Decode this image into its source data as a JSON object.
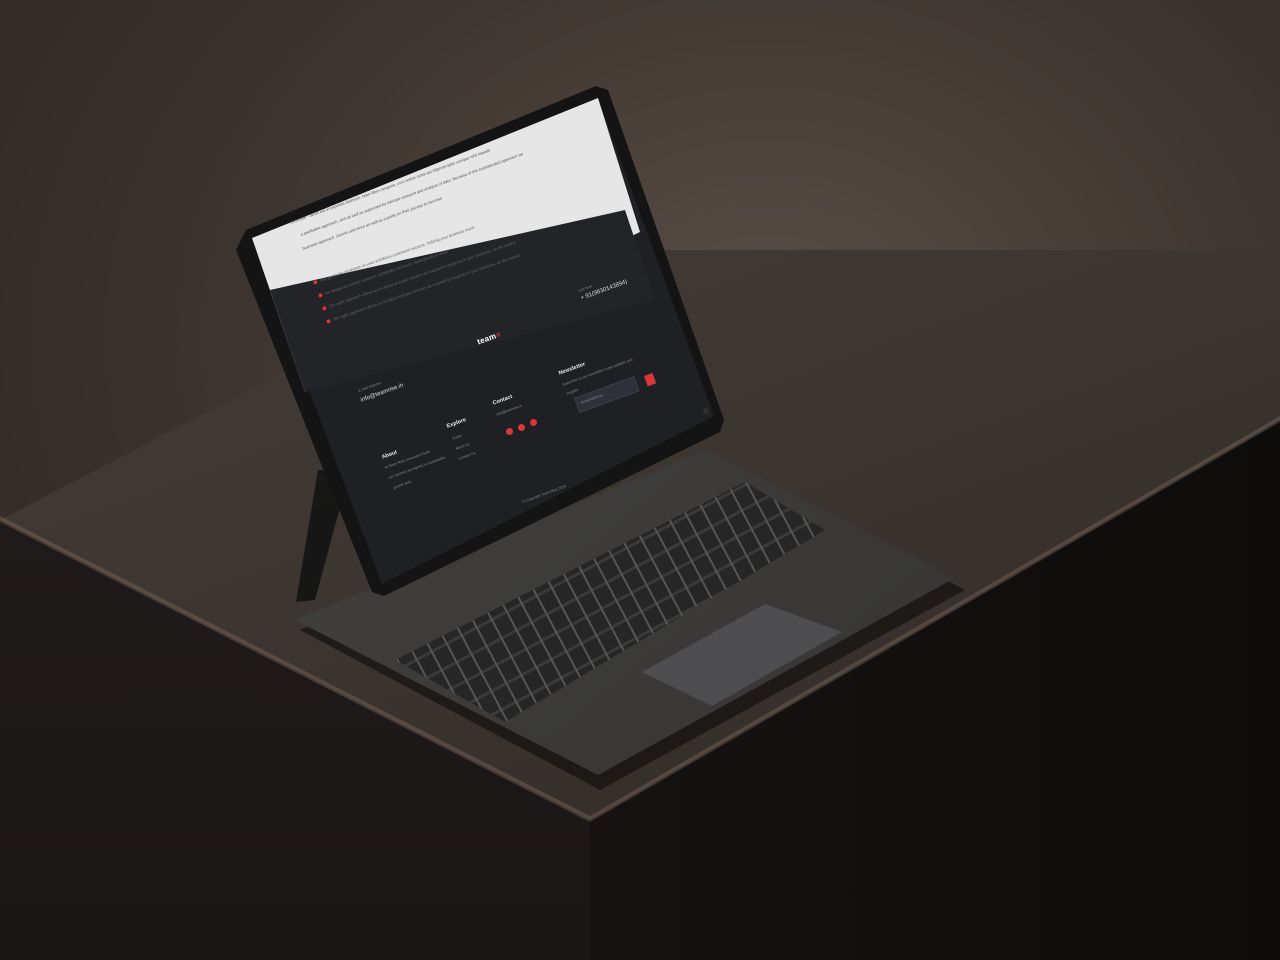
{
  "content": {
    "paragraphs": [
      "conciliate - facilis est et expedita distinctio. Nam libero tempore, cum soluta nobis est eligendi optio cumque nihil impedit",
      "a qualitative approach, and as well as supported by intricate research and analysis of data. Because of the sophisticated approach we",
      "business approach. Dennis and more as well as a pretty on their journey to success"
    ],
    "bullets": [
      "Pay particular emphasis on your ambitious customers success. Helping your business reach",
      "we always do market research, competitor research, strategically is ready",
      "Our agile approach allows us to adjust and gain traction as required to progress in your business, on the market",
      "Our agile approach allows us to adjust and gain traction as required to progress in your business, on the market"
    ]
  },
  "footer": {
    "logo_main": "team",
    "logo_accent": "≡",
    "email_label": "E-mail Address",
    "email": "info@teamrise.in",
    "phone_label": "Call Now",
    "phone": "+ 91(9830143894)",
    "about": {
      "title": "About",
      "lines": [
        "At Team Rise, innovation fuels",
        "our success as experts in sustainable",
        "growth and..."
      ]
    },
    "explore": {
      "title": "Explore",
      "items": [
        "Home",
        "About us",
        "Contact Us"
      ]
    },
    "contact": {
      "title": "Contact",
      "email": "info@teamrise.in"
    },
    "newsletter": {
      "title": "Newsletter",
      "desc": "Subscribe to our newsletter to get updates and",
      "desc2": "insights",
      "placeholder": "Email Address"
    },
    "copyright": "© Copyright Team Rise 2024"
  },
  "colors": {
    "accent": "#d8383a",
    "footer_bg": "#1f2023",
    "content_bg": "#e6e6e6"
  }
}
